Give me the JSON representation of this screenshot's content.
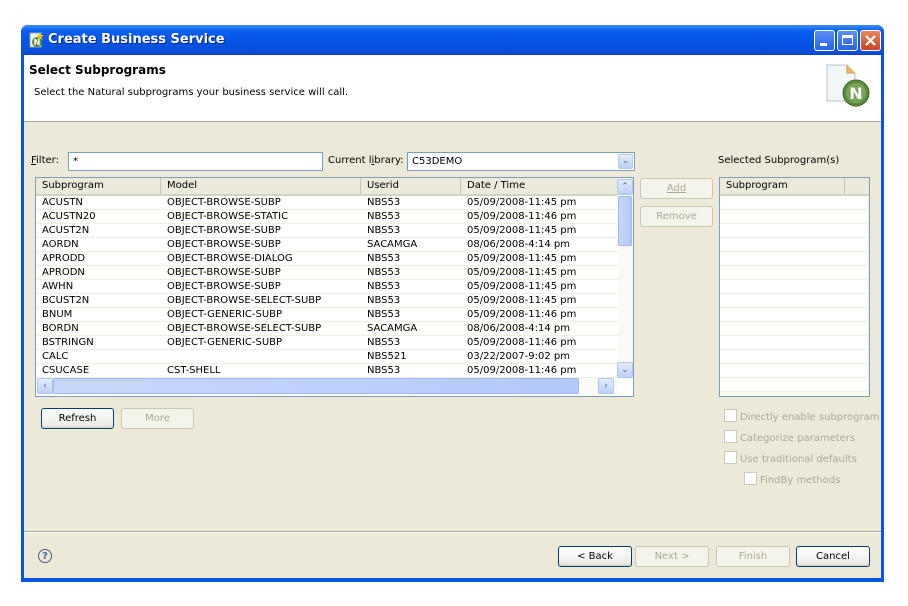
{
  "window": {
    "title": "Create Business Service",
    "controls": [
      "minimize",
      "maximize",
      "close"
    ]
  },
  "header": {
    "title": "Select Subprograms",
    "description": "Select the Natural subprograms your business service will call.",
    "icon": "natural-n-document-icon"
  },
  "filter": {
    "label": "Filter:",
    "value": "*"
  },
  "library": {
    "label": "Current library:",
    "value": "C53DEMO"
  },
  "subprogram_table": {
    "columns": [
      "Subprogram",
      "Model",
      "Userid",
      "Date / Time"
    ],
    "rows": [
      [
        "ACUSTN",
        "OBJECT-BROWSE-SUBP",
        "NBS53",
        "05/09/2008-11:45 pm"
      ],
      [
        "ACUSTN20",
        "OBJECT-BROWSE-STATIC",
        "NBS53",
        "05/09/2008-11:46 pm"
      ],
      [
        "ACUST2N",
        "OBJECT-BROWSE-SUBP",
        "NBS53",
        "05/09/2008-11:45 pm"
      ],
      [
        "AORDN",
        "OBJECT-BROWSE-SUBP",
        "SACAMGA",
        "08/06/2008-4:14 pm"
      ],
      [
        "APRODD",
        "OBJECT-BROWSE-DIALOG",
        "NBS53",
        "05/09/2008-11:45 pm"
      ],
      [
        "APRODN",
        "OBJECT-BROWSE-SUBP",
        "NBS53",
        "05/09/2008-11:45 pm"
      ],
      [
        "AWHN",
        "OBJECT-BROWSE-SUBP",
        "NBS53",
        "05/09/2008-11:45 pm"
      ],
      [
        "BCUST2N",
        "OBJECT-BROWSE-SELECT-SUBP",
        "NBS53",
        "05/09/2008-11:45 pm"
      ],
      [
        "BNUM",
        "OBJECT-GENERIC-SUBP",
        "NBS53",
        "05/09/2008-11:46 pm"
      ],
      [
        "BORDN",
        "OBJECT-BROWSE-SELECT-SUBP",
        "SACAMGA",
        "08/06/2008-4:14 pm"
      ],
      [
        "BSTRINGN",
        "OBJECT-GENERIC-SUBP",
        "NBS53",
        "05/09/2008-11:46 pm"
      ],
      [
        "CALC",
        "",
        "NBS521",
        "03/22/2007-9:02 pm"
      ],
      [
        "CSUCASE",
        "CST-SHELL",
        "NBS53",
        "05/09/2008-11:46 pm"
      ]
    ]
  },
  "middle_buttons": {
    "add": "Add",
    "remove": "Remove"
  },
  "selected": {
    "label": "Selected Subprogram(s)",
    "columns": [
      "Subprogram"
    ],
    "rows": []
  },
  "list_buttons": {
    "refresh": "Refresh",
    "more": "More"
  },
  "options": [
    {
      "label": "Directly enable subprogram",
      "checked": false,
      "enabled": false
    },
    {
      "label": "Categorize parameters",
      "checked": false,
      "enabled": false
    },
    {
      "label": "Use traditional defaults",
      "checked": false,
      "enabled": false
    },
    {
      "label": "FindBy methods",
      "checked": false,
      "enabled": false
    }
  ],
  "footer": {
    "help": "?",
    "back": "< Back",
    "next": "Next >",
    "finish": "Finish",
    "cancel": "Cancel"
  }
}
